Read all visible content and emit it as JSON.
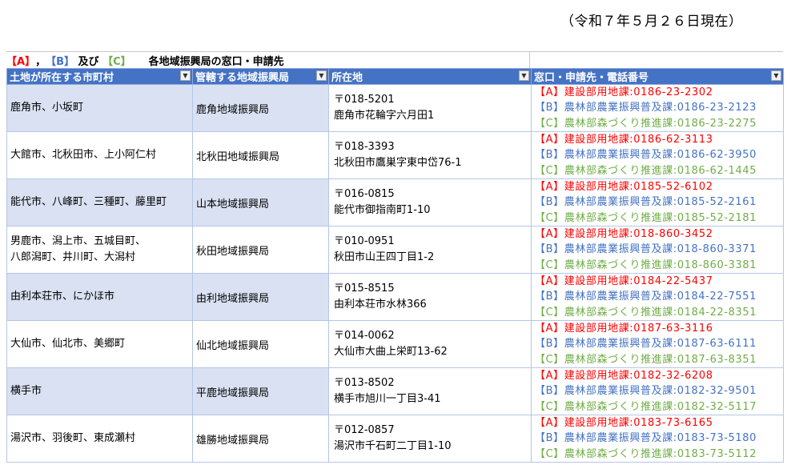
{
  "date_note": "（令和７年５月２６日現在）",
  "legend": {
    "a": "【A】",
    "comma": "，",
    "b": "【B】",
    "and": " 及び ",
    "c": "【C】",
    "title": "各地域振興局の窓口・申請先"
  },
  "headers": [
    "土地が所在する市町村",
    "管轄する地域振興局",
    "所在地",
    "窓口・申請先・電話番号"
  ],
  "rows": [
    {
      "muni": [
        "鹿角市、小坂町"
      ],
      "office": "鹿角地域振興局",
      "postal": "〒018-5201",
      "address": "鹿角市花輪字六月田1",
      "a": "【A】建設部用地課:0186-23-2302",
      "b": "【B】農林部農業振興普及課:0186-23-2123",
      "c": "【C】農林部森づくり推進課:0186-23-2275"
    },
    {
      "muni": [
        "大館市、北秋田市、上小阿仁村"
      ],
      "office": "北秋田地域振興局",
      "postal": "〒018-3393",
      "address": "北秋田市鷹巣字東中岱76-1",
      "a": "【A】建設部用地課:0186-62-3113",
      "b": "【B】農林部農業振興普及課:0186-62-3950",
      "c": "【C】農林部森づくり推進課:0186-62-1445"
    },
    {
      "muni": [
        "能代市、八峰町、三種町、藤里町"
      ],
      "office": "山本地域振興局",
      "postal": "〒016-0815",
      "address": "能代市御指南町1-10",
      "a": "【A】建設部用地課:0185-52-6102",
      "b": "【B】農林部農業振興普及課:0185-52-2161",
      "c": "【C】農林部森づくり推進課:0185-52-2181"
    },
    {
      "muni": [
        "男鹿市、潟上市、五城目町、",
        "八郎潟町、井川町、大潟村"
      ],
      "office": "秋田地域振興局",
      "postal": "〒010-0951",
      "address": "秋田市山王四丁目1-2",
      "a": "【A】建設部用地課:018-860-3452",
      "b": "【B】農林部農業振興普及課:018-860-3371",
      "c": "【C】農林部森づくり推進課:018-860-3381"
    },
    {
      "muni": [
        "由利本荘市、にかほ市"
      ],
      "office": "由利地域振興局",
      "postal": "〒015-8515",
      "address": "由利本荘市水林366",
      "a": "【A】建設部用地課:0184-22-5437",
      "b": "【B】農林部農業振興普及課:0184-22-7551",
      "c": "【C】農林部森づくり推進課:0184-22-8351"
    },
    {
      "muni": [
        "大仙市、仙北市、美郷町"
      ],
      "office": "仙北地域振興局",
      "postal": "〒014-0062",
      "address": "大仙市大曲上栄町13-62",
      "a": "【A】建設部用地課:0187-63-3116",
      "b": "【B】農林部農業振興普及課:0187-63-6111",
      "c": "【C】農林部森づくり推進課:0187-63-8351"
    },
    {
      "muni": [
        "横手市"
      ],
      "office": "平鹿地域振興局",
      "postal": "〒013-8502",
      "address": "横手市旭川一丁目3-41",
      "a": "【A】建設部用地課:0182-32-6208",
      "b": "【B】農林部農業振興普及課:0182-32-9501",
      "c": "【C】農林部森づくり推進課:0182-32-5117"
    },
    {
      "muni": [
        "湯沢市、羽後町、東成瀬村"
      ],
      "office": "雄勝地域振興局",
      "postal": "〒012-0857",
      "address": "湯沢市千石町二丁目1-10",
      "a": "【A】建設部用地課:0183-73-6165",
      "b": "【B】農林部農業振興普及課:0183-73-5180",
      "c": "【C】農林部森づくり推進課:0183-73-5112"
    }
  ],
  "colors": {
    "header_bg": "#4472c4",
    "band": "#d9e1f2",
    "a": "#ff0000",
    "b": "#4472c4",
    "c": "#70ad47"
  }
}
